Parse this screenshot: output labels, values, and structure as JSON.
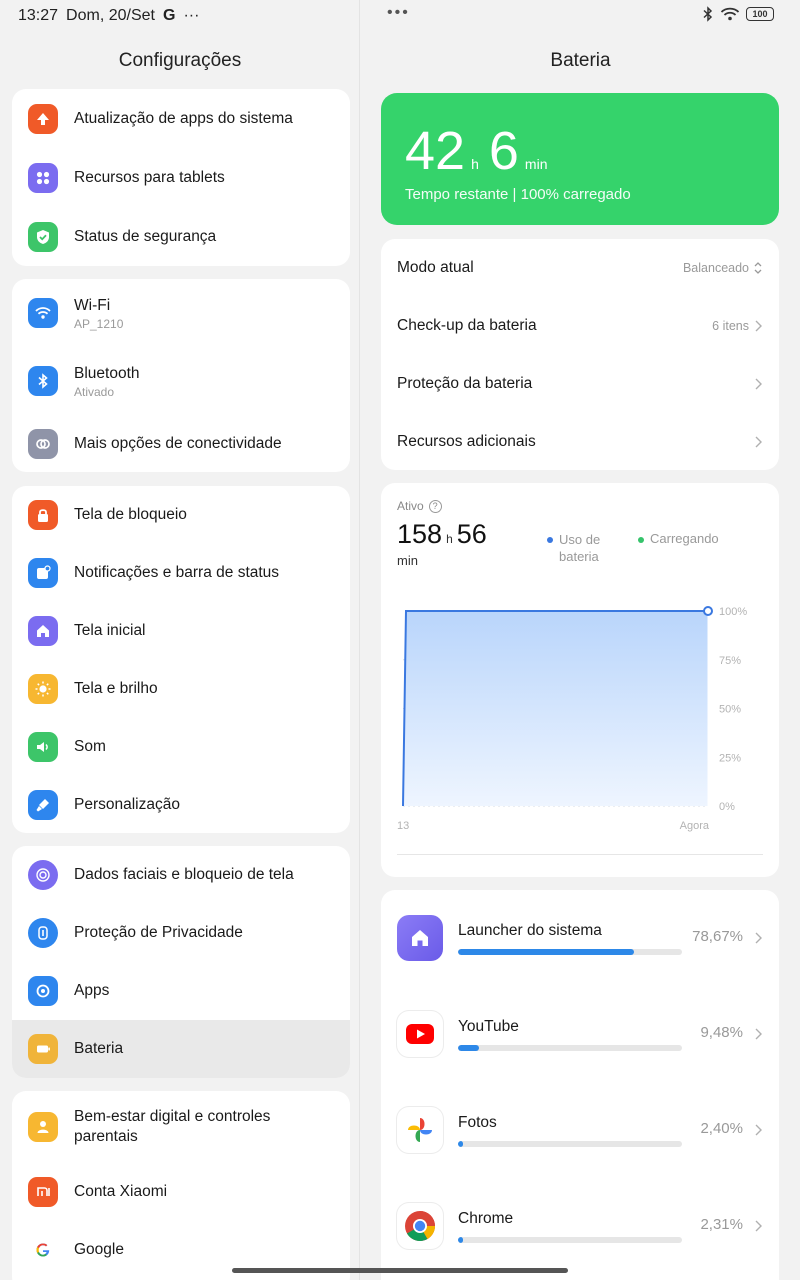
{
  "statusbar": {
    "time": "13:27",
    "date": "Dom, 20/Set",
    "google": "G",
    "more": "···",
    "dots": "•••",
    "battery": "100"
  },
  "left": {
    "title": "Configurações",
    "groups": [
      {
        "items": [
          {
            "label": "Atualização de apps do sistema",
            "icon": "arrow-up-icon",
            "color": "#f05a28"
          },
          {
            "label": "Recursos para tablets",
            "icon": "grid-icon",
            "color": "#7b6cf0"
          },
          {
            "label": "Status de segurança",
            "icon": "shield-check-icon",
            "color": "#3dc569"
          }
        ]
      },
      {
        "items": [
          {
            "label": "Wi-Fi",
            "sub": "AP_1210",
            "icon": "wifi-icon",
            "color": "#2e86ee"
          },
          {
            "label": "Bluetooth",
            "sub": "Ativado",
            "icon": "bluetooth-icon",
            "color": "#2e86ee"
          },
          {
            "label": "Mais opções de conectividade",
            "icon": "link-icon",
            "color": "#8f94a8"
          }
        ]
      },
      {
        "items": [
          {
            "label": "Tela de bloqueio",
            "icon": "lock-icon",
            "color": "#f05a28"
          },
          {
            "label": "Notificações e barra de status",
            "icon": "notification-icon",
            "color": "#2e86ee"
          },
          {
            "label": "Tela inicial",
            "icon": "home-icon",
            "color": "#7b6cf0"
          },
          {
            "label": "Tela e brilho",
            "icon": "sun-icon",
            "color": "#f7b731"
          },
          {
            "label": "Som",
            "icon": "speaker-icon",
            "color": "#3dc569"
          },
          {
            "label": "Personalização",
            "icon": "brush-icon",
            "color": "#2e86ee"
          }
        ]
      },
      {
        "items": [
          {
            "label": "Dados faciais e bloqueio de tela",
            "icon": "face-icon",
            "color": "#7b6cf0"
          },
          {
            "label": "Proteção de Privacidade",
            "icon": "privacy-icon",
            "color": "#2e86ee"
          },
          {
            "label": "Apps",
            "icon": "apps-icon",
            "color": "#2e86ee"
          },
          {
            "label": "Bateria",
            "icon": "battery-icon",
            "color": "#f0b43a",
            "selected": true
          }
        ]
      },
      {
        "items": [
          {
            "label": "Bem-estar digital e controles parentais",
            "icon": "wellbeing-icon",
            "color": "#f7b731"
          },
          {
            "label": "Conta Xiaomi",
            "icon": "xiaomi-icon",
            "color": "#f05a28"
          },
          {
            "label": "Google",
            "icon": "google-icon",
            "color": "#ffffff"
          }
        ]
      }
    ]
  },
  "right": {
    "title": "Bateria",
    "hero": {
      "hours": "42",
      "h": "h",
      "mins": "6",
      "min": "min",
      "desc": "Tempo restante | 100% carregado",
      "color": "#35d36b"
    },
    "settings": [
      {
        "label": "Modo atual",
        "value": "Balanceado"
      },
      {
        "label": "Check-up da bateria",
        "value": "6 itens"
      },
      {
        "label": "Proteção da bateria",
        "value": ""
      },
      {
        "label": "Recursos adicionais",
        "value": ""
      }
    ],
    "usage": {
      "ativo": "Ativo",
      "help": "?",
      "hours": "158",
      "h": "h",
      "mins": "56",
      "min": "min",
      "legend_usage_1": "Uso de",
      "legend_usage_2": "bateria",
      "legend_charging": "Carregando"
    },
    "apps": [
      {
        "name": "Launcher do sistema",
        "pct": "78,67%",
        "value": 0.7867,
        "icon": "launcher-icon"
      },
      {
        "name": "YouTube",
        "pct": "9,48%",
        "value": 0.0948,
        "icon": "youtube-icon"
      },
      {
        "name": "Fotos",
        "pct": "2,40%",
        "value": 0.024,
        "icon": "photos-icon"
      },
      {
        "name": "Chrome",
        "pct": "2,31%",
        "value": 0.0231,
        "icon": "chrome-icon"
      }
    ]
  },
  "chart_data": {
    "type": "area",
    "x": [
      "13",
      "Agora"
    ],
    "series": [
      {
        "name": "Uso de bateria",
        "values": [
          100,
          100
        ]
      }
    ],
    "y_ticks": [
      "100%",
      "75%",
      "50%",
      "25%",
      "0%"
    ],
    "x_ticks": [
      "13",
      "Agora"
    ],
    "ylim": [
      0,
      100
    ],
    "colors": {
      "line": "#3a78e0",
      "fill_top": "#b9d5fb",
      "charging": "#35c36b"
    }
  }
}
